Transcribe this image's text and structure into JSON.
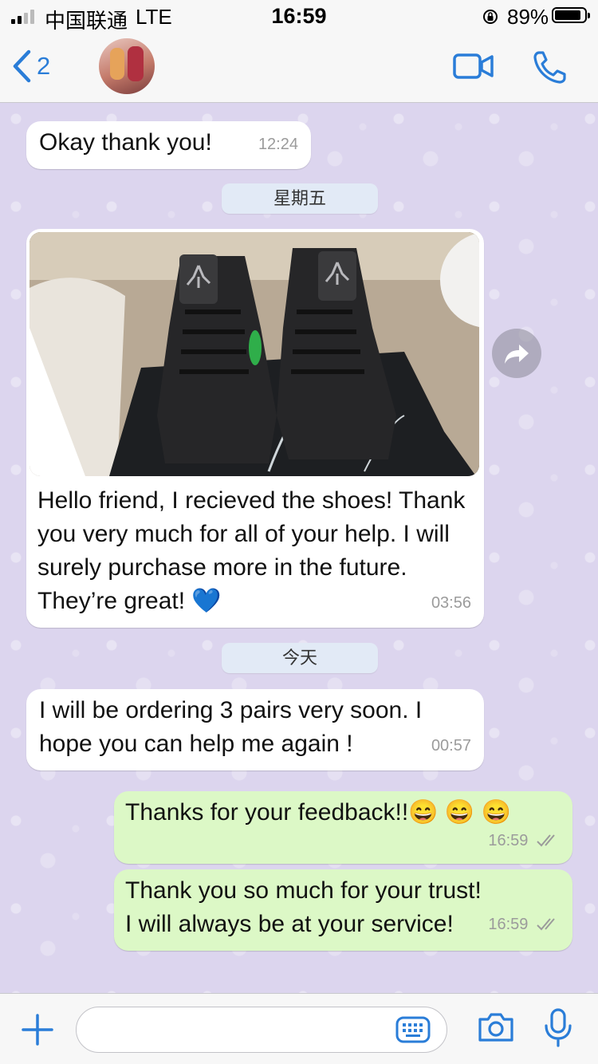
{
  "status_bar": {
    "carrier": "中国联通",
    "network": "LTE",
    "time": "16:59",
    "battery_percent_label": "89%",
    "battery_level": 0.89
  },
  "header": {
    "back_count": "2",
    "contact_name": "",
    "icons": [
      "chevron-left-icon",
      "video-camera-icon",
      "phone-icon"
    ]
  },
  "messages": [
    {
      "direction": "in",
      "text": "Okay thank you!",
      "time": "12:24"
    },
    {
      "direction": "divider",
      "text": "星期五"
    },
    {
      "direction": "in",
      "type": "image",
      "text": "Hello friend, I recieved the shoes! Thank you very much for all of your help. I will surely purchase more in the future. They’re great! 💙",
      "time": "03:56"
    },
    {
      "direction": "divider",
      "text": "今天"
    },
    {
      "direction": "in",
      "text": "I will be ordering 3 pairs very soon. I hope you can help me again !",
      "time": "00:57"
    },
    {
      "direction": "out",
      "text": "Thanks for your feedback!!😄 😄 😄",
      "time": "16:59",
      "status": "read"
    },
    {
      "direction": "out",
      "text": "Thank you so much for your trust! I will always be at your service!",
      "time": "16:59",
      "status": "read"
    }
  ],
  "input_bar": {
    "placeholder": "",
    "icons": [
      "plus-icon",
      "keyboard-sticker-icon",
      "camera-icon",
      "microphone-icon"
    ]
  },
  "colors": {
    "accent": "#2a7dd8",
    "incoming_bubble": "#ffffff",
    "outgoing_bubble": "#dcf8c6",
    "chat_background": "#dcd5ee",
    "date_pill": "#e2eaf6"
  }
}
